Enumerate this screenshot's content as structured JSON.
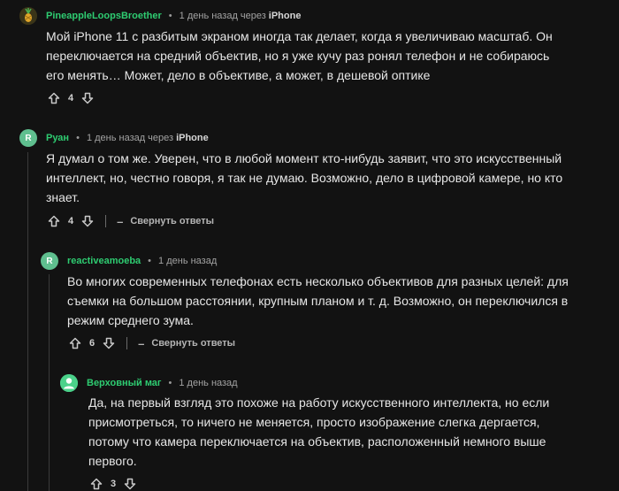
{
  "comments": [
    {
      "author": "PineappleLoopsBroether",
      "separator": "•",
      "time": "1 день назад",
      "via": "через",
      "device": "iPhone",
      "avatar_letter": "",
      "avatar_color": "#3a3a1e",
      "text": [
        "Мой iPhone 11 с разбитым экраном иногда так делает, когда я увеличиваю масштаб. Он",
        "переключается на средний объектив, но я уже кучу раз ронял телефон и не собираюсь",
        "его менять… Может, дело в объективе, а может, в дешевой оптике"
      ],
      "score": "4",
      "collapse_label": ""
    },
    {
      "author": "Руан",
      "separator": "•",
      "time": "1 день назад",
      "via": "через",
      "device": "iPhone",
      "avatar_letter": "R",
      "avatar_color": "#5fbf8f",
      "text": [
        "Я думал о том же. Уверен, что в любой момент кто-нибудь заявит, что это искусственный",
        "интеллект, но, честно говоря, я так не думаю. Возможно, дело в цифровой камере, но кто",
        "знает."
      ],
      "score": "4",
      "collapse_label": "Свернуть ответы",
      "collapse_symbol": "–"
    },
    {
      "author": "reactiveamoeba",
      "separator": "•",
      "time": "1 день назад",
      "via": "",
      "device": "",
      "avatar_letter": "R",
      "avatar_color": "#5fbf8f",
      "text": [
        "Во многих современных телефонах есть несколько объективов для разных целей: для",
        "съемки на большом расстоянии, крупным планом и т. д. Возможно, он переключился в",
        "режим среднего зума."
      ],
      "score": "6",
      "collapse_label": "Свернуть ответы",
      "collapse_symbol": "–"
    },
    {
      "author": "Верховный маг",
      "separator": "•",
      "time": "1 день назад",
      "via": "",
      "device": "",
      "avatar_letter": "",
      "avatar_color": "#4bd18a",
      "text": [
        "Да, на первый взгляд это похоже на работу искусственного интеллекта, но если",
        "присмотреться, то ничего не меняется, просто изображение слегка дергается,",
        "потому что камера переключается на объектив, расположенный немного выше",
        "первого."
      ],
      "score": "3",
      "collapse_label": ""
    }
  ],
  "icons": {
    "upvote": "arrow-up-icon",
    "downvote": "arrow-down-icon"
  },
  "colors": {
    "background": "#121212",
    "author": "#2ecc71",
    "text": "#e6e6e6"
  }
}
